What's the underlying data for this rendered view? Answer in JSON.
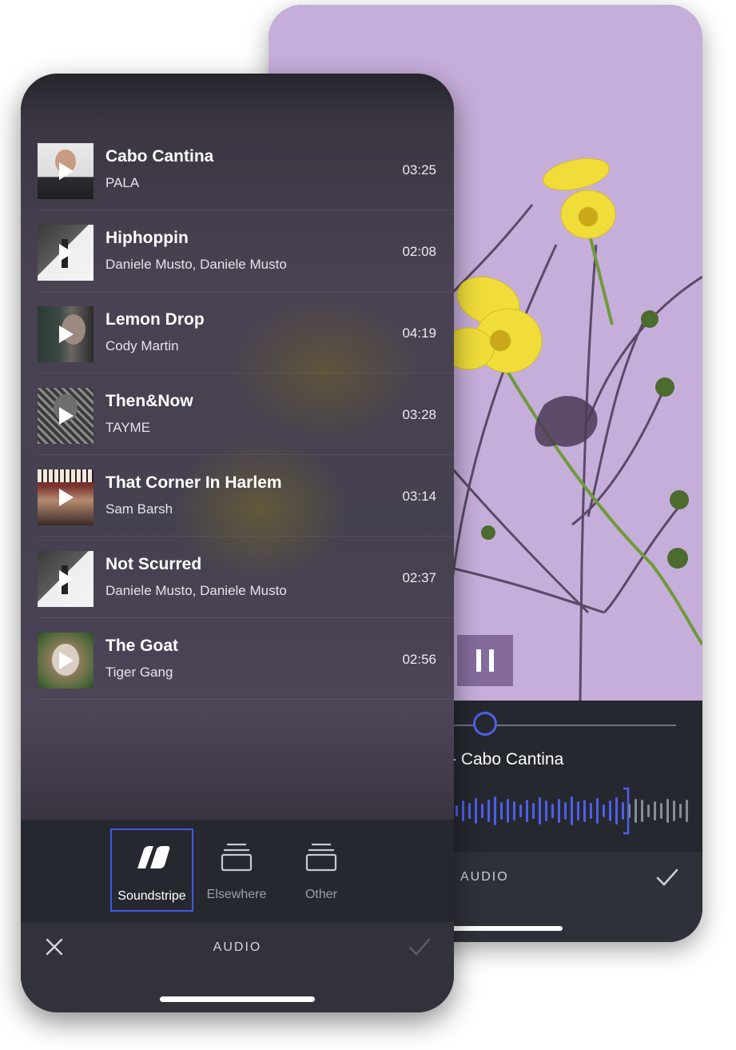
{
  "back_phone": {
    "now_playing_title": "- Cabo Cantina",
    "toolbar_label": "AUDIO",
    "colors": {
      "photo_bg": "#c5aed9",
      "accent": "#4e5fe8",
      "panel": "#262830"
    },
    "icons": {
      "pause": "pause-icon",
      "confirm": "checkmark-icon"
    }
  },
  "front_phone": {
    "tracks": [
      {
        "title": "Cabo Cantina",
        "artist": "PALA",
        "duration": "03:25"
      },
      {
        "title": "Hiphoppin",
        "artist": "Daniele Musto, Daniele Musto",
        "duration": "02:08"
      },
      {
        "title": "Lemon Drop",
        "artist": "Cody Martin",
        "duration": "04:19"
      },
      {
        "title": "Then&Now",
        "artist": "TAYME",
        "duration": "03:28"
      },
      {
        "title": "That Corner In Harlem",
        "artist": "Sam Barsh",
        "duration": "03:14"
      },
      {
        "title": "Not Scurred",
        "artist": "Daniele Musto, Daniele Musto",
        "duration": "02:37"
      },
      {
        "title": "The Goat",
        "artist": "Tiger Gang",
        "duration": "02:56"
      }
    ],
    "tabs": [
      {
        "label": "Soundstripe",
        "icon": "soundstripe-logo-icon",
        "active": true
      },
      {
        "label": "Elsewhere",
        "icon": "stacked-layers-icon",
        "active": false
      },
      {
        "label": "Other",
        "icon": "stacked-layers-icon",
        "active": false
      }
    ],
    "toolbar_label": "AUDIO",
    "icons": {
      "close": "close-icon",
      "confirm": "checkmark-icon",
      "play": "play-icon"
    },
    "colors": {
      "active_tab_border": "#4058e6",
      "tabbar": "#262830",
      "toolbar": "#31323a"
    }
  }
}
